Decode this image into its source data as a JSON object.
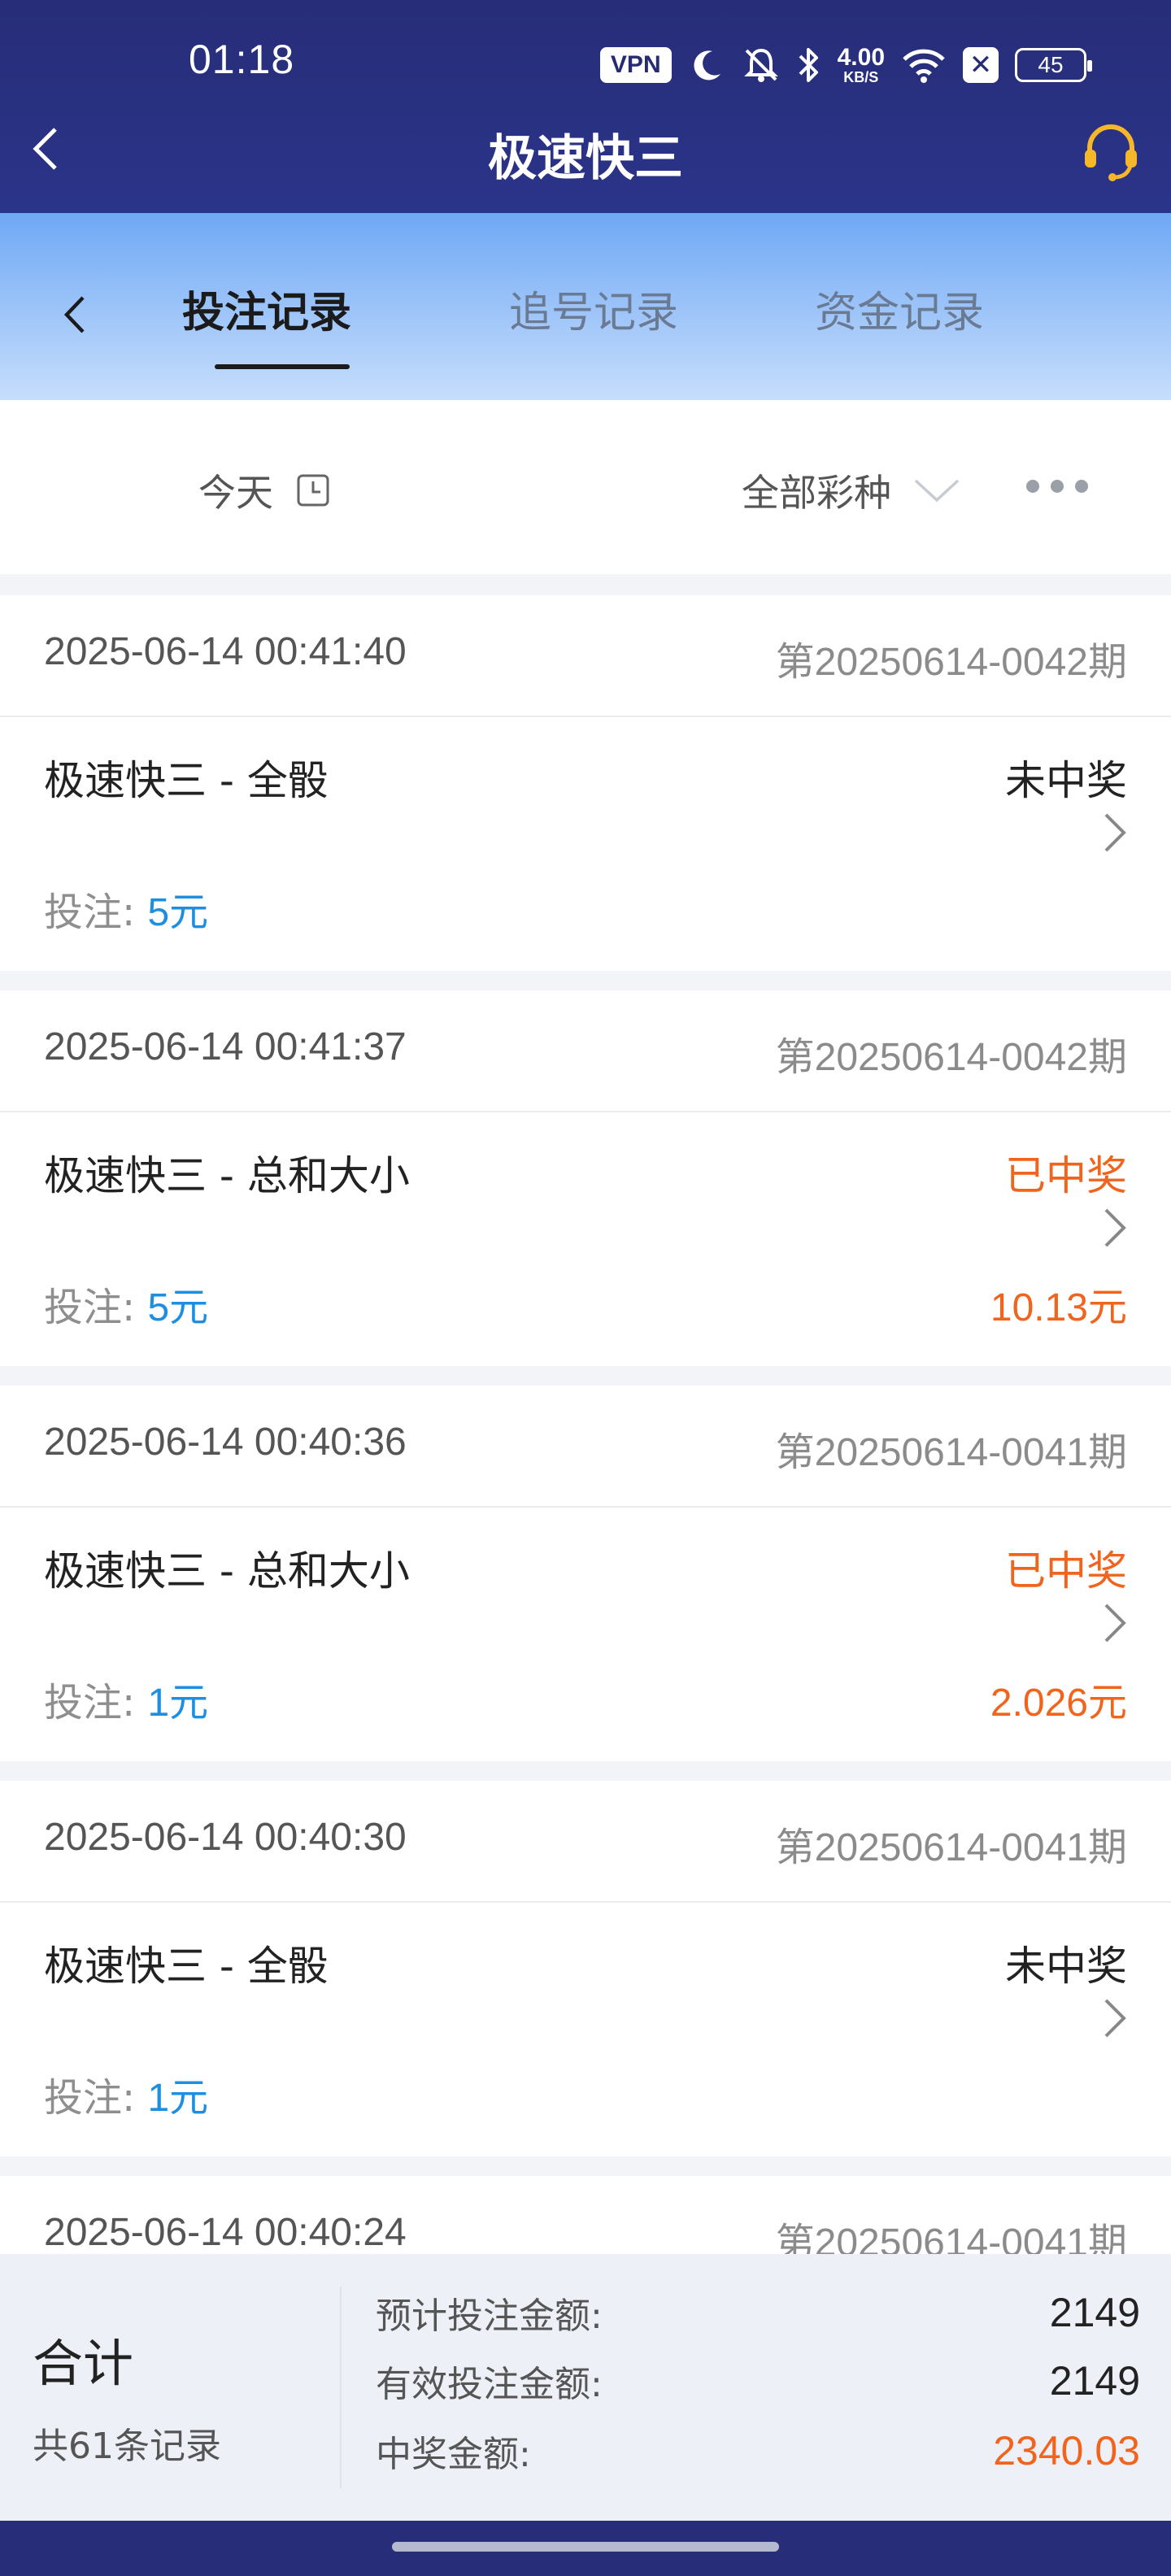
{
  "status_bar": {
    "time": "01:18",
    "vpn": "VPN",
    "speed_value": "4.00",
    "speed_unit": "KB/S",
    "battery": "45",
    "icons": [
      "vpn-icon",
      "moon-icon",
      "mute-bell-icon",
      "bluetooth-icon",
      "wifi-icon",
      "close-box-icon",
      "battery-icon"
    ]
  },
  "header": {
    "title": "极速快三",
    "back_icon": "chevron-left-icon",
    "support_icon": "headset-icon"
  },
  "tabs": {
    "items": [
      {
        "label": "投注记录",
        "active": true
      },
      {
        "label": "追号记录",
        "active": false
      },
      {
        "label": "资金记录",
        "active": false
      }
    ]
  },
  "filter": {
    "date_label": "今天",
    "type_label": "全部彩种",
    "date_icon": "clock-icon",
    "type_icon": "chevron-down-icon",
    "more_icon": "more-dots-icon"
  },
  "records": [
    {
      "time": "2025-06-14 00:41:40",
      "period": "第20250614-0042期",
      "game": "极速快三 - 全骰",
      "status": "未中奖",
      "won": false,
      "bet_label": "投注:",
      "bet_amount": "5元",
      "prize": ""
    },
    {
      "time": "2025-06-14 00:41:37",
      "period": "第20250614-0042期",
      "game": "极速快三 - 总和大小",
      "status": "已中奖",
      "won": true,
      "bet_label": "投注:",
      "bet_amount": "5元",
      "prize": "10.13元"
    },
    {
      "time": "2025-06-14 00:40:36",
      "period": "第20250614-0041期",
      "game": "极速快三 - 总和大小",
      "status": "已中奖",
      "won": true,
      "bet_label": "投注:",
      "bet_amount": "1元",
      "prize": "2.026元"
    },
    {
      "time": "2025-06-14 00:40:30",
      "period": "第20250614-0041期",
      "game": "极速快三 - 全骰",
      "status": "未中奖",
      "won": false,
      "bet_label": "投注:",
      "bet_amount": "1元",
      "prize": ""
    },
    {
      "time": "2025-06-14 00:40:24",
      "period": "第20250614-0041期",
      "game": "",
      "status": "",
      "won": false,
      "bet_label": "",
      "bet_amount": "",
      "prize": ""
    }
  ],
  "summary": {
    "total_label": "合计",
    "count_text": "共61条记录",
    "expected_label": "预计投注金额:",
    "expected_value": "2149",
    "valid_label": "有效投注金额:",
    "valid_value": "2149",
    "prize_label": "中奖金额:",
    "prize_value": "2340.03"
  },
  "colors": {
    "header_bg": "#272d78",
    "tab_gradient_top": "#6fa8f5",
    "win_orange": "#f0641e",
    "bet_blue": "#1e8fe0"
  }
}
